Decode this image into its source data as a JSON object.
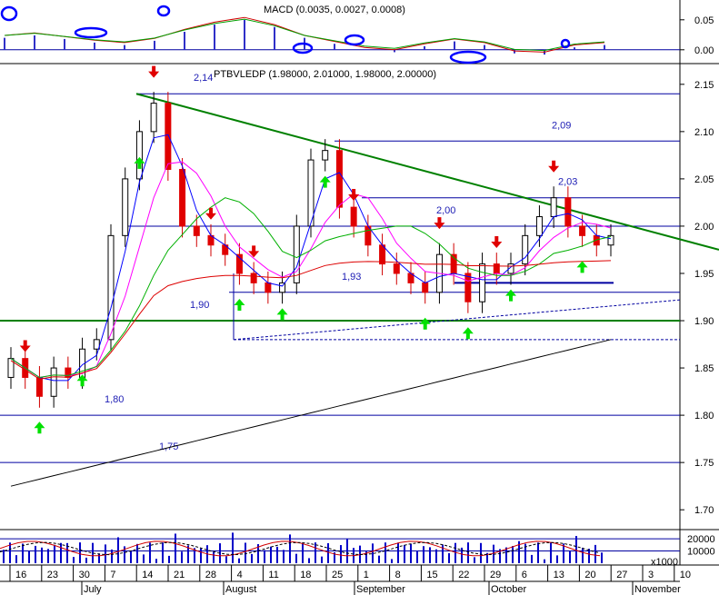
{
  "chart_data": [
    {
      "type": "macd",
      "panel": "indicator-top",
      "title": "MACD (0.0035, 0.0027, 0.0008)",
      "ylim": [
        -0.02,
        0.08
      ],
      "y_ticks": [
        0.05,
        0.0
      ],
      "y_tick_labels": [
        "0.05",
        "0.00"
      ],
      "histogram_bars": 21,
      "highlight_ellipses": 7
    },
    {
      "type": "candlestick",
      "panel": "price",
      "title": "PTBVLEDP (1.98000, 2.01000, 1.98000, 2.00000)",
      "ylim": [
        1.68,
        2.17
      ],
      "y_ticks": [
        2.15,
        2.1,
        2.05,
        2.0,
        1.95,
        1.9,
        1.85,
        1.8,
        1.75,
        1.7
      ],
      "y_tick_labels": [
        "2.15",
        "2.10",
        "2.05",
        "2.00",
        "1.95",
        "1.90",
        "1.85",
        "1.80",
        "1.75",
        "1.70"
      ],
      "x_day_labels": [
        "16",
        "23",
        "30",
        "7",
        "14",
        "21",
        "28",
        "4",
        "11",
        "18",
        "25",
        "1",
        "8",
        "15",
        "22",
        "29",
        "6",
        "13",
        "20",
        "27",
        "3",
        "10"
      ],
      "x_month_labels": [
        "July",
        "August",
        "September",
        "October",
        "November"
      ],
      "horizontal_levels": [
        {
          "value": 2.14,
          "label": "2,14"
        },
        {
          "value": 2.09,
          "label": "2,09"
        },
        {
          "value": 2.03,
          "label": "2,03"
        },
        {
          "value": 2.0,
          "label": "2,00"
        },
        {
          "value": 1.93,
          "label": "1,93"
        },
        {
          "value": 1.9,
          "label": "1,90"
        },
        {
          "value": 1.8,
          "label": "1,80"
        },
        {
          "value": 1.75,
          "label": "1,75"
        }
      ],
      "trendline": {
        "from": 2.14,
        "to": 1.975
      },
      "closes": [
        1.86,
        1.84,
        1.82,
        1.85,
        1.84,
        1.87,
        1.88,
        1.99,
        2.05,
        2.1,
        2.13,
        2.06,
        2.0,
        1.99,
        1.98,
        1.97,
        1.95,
        1.94,
        1.93,
        1.94,
        2.0,
        2.07,
        2.08,
        2.02,
        2.0,
        1.98,
        1.96,
        1.95,
        1.94,
        1.93,
        1.97,
        1.95,
        1.92,
        1.96,
        1.95,
        1.96,
        1.99,
        2.01,
        2.03,
        2.0,
        1.99,
        1.98,
        1.99
      ],
      "ma_fast_color": "#0000ff",
      "ma_mid_color": "#ff00ff",
      "ma_slow_color": "#00b000",
      "ma_50_color": "#dd0000",
      "ma_200_color": "#000000",
      "buy_arrow_color": "#00e000",
      "sell_arrow_color": "#e00000"
    },
    {
      "type": "volume",
      "panel": "volume",
      "y_ticks": [
        20000,
        10000
      ],
      "y_tick_labels": [
        "20000",
        "10000"
      ],
      "unit_label": "x1000"
    }
  ]
}
